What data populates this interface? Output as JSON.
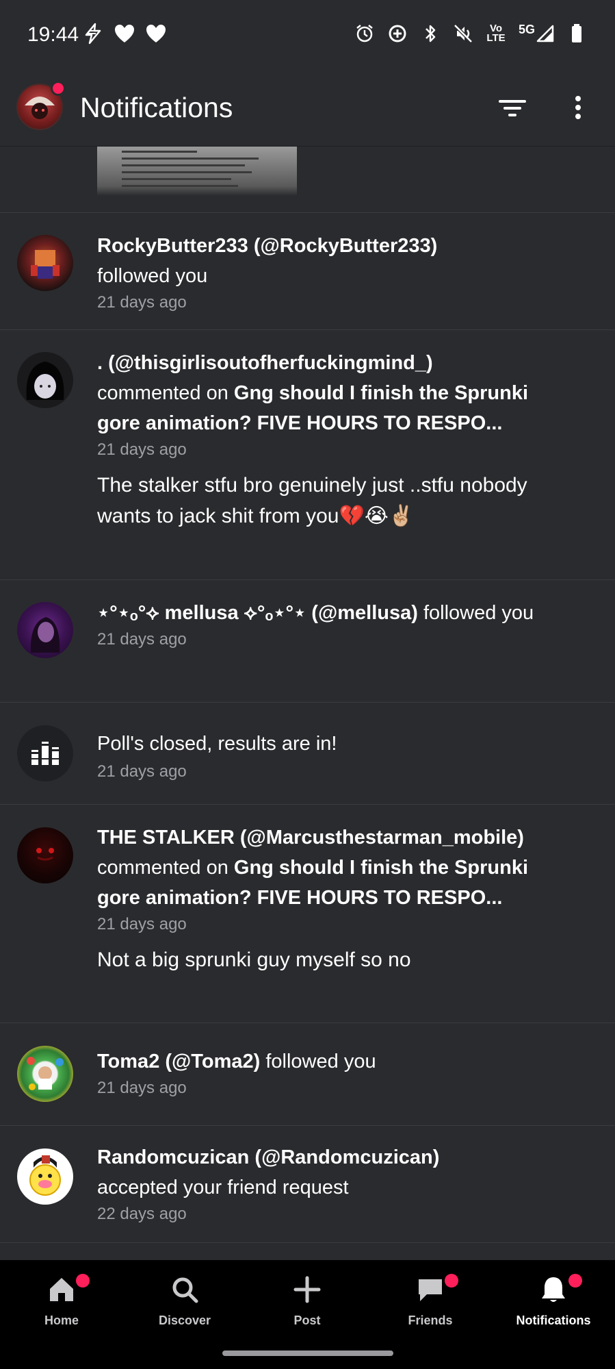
{
  "status_bar": {
    "time": "19:44",
    "network_label": "Vo½\nLTE",
    "network_top": "Vo",
    "network_bottom": "LTE",
    "fiveg": "5G"
  },
  "app_bar": {
    "title": "Notifications"
  },
  "notifications": [
    {
      "user": "RockyButter233 (@RockyButter233)",
      "action": "followed you",
      "time": "21 days ago"
    },
    {
      "user": ". (@thisgirlisoutofherfuckingmind_)",
      "action_prefix": "commented on",
      "post_title": "Gng should I finish the Sprunki gore animation? FIVE HOURS TO RESPO...",
      "time": "21 days ago",
      "comment": "The stalker stfu bro genuinely just ..stfu nobody wants to jack shit from you💔😭✌🏼"
    },
    {
      "user": "⋆°⋆ₒ°⟡ mellusa ⟡°ₒ⋆°⋆ (@mellusa)",
      "action": "followed you",
      "time": "21 days ago"
    },
    {
      "action": "Poll's closed, results are in!",
      "time": "21 days ago"
    },
    {
      "user": "THE STALKER (@Marcusthestarman_mobile)",
      "action_prefix": "commented on",
      "post_title": "Gng should I finish the Sprunki gore animation? FIVE HOURS TO RESPO...",
      "time": "21 days ago",
      "comment": "Not a big sprunki guy myself so no"
    },
    {
      "user": "Toma2 (@Toma2)",
      "action": "followed you",
      "time": "21 days ago"
    },
    {
      "user": "Randomcuzican (@Randomcuzican)",
      "action": "accepted your friend request",
      "time": "22 days ago"
    }
  ],
  "bottom_nav": {
    "items": [
      {
        "label": "Home",
        "icon": "home-icon",
        "badge": true
      },
      {
        "label": "Discover",
        "icon": "search-icon",
        "badge": false
      },
      {
        "label": "Post",
        "icon": "plus-icon",
        "badge": false
      },
      {
        "label": "Friends",
        "icon": "chat-icon",
        "badge": true
      },
      {
        "label": "Notifications",
        "icon": "bell-icon",
        "badge": true,
        "active": true
      }
    ]
  },
  "colors": {
    "background": "#2a2b2e",
    "divider": "#3b3c40",
    "badge": "#ff1f5a",
    "secondary_text": "#9ea0a6",
    "nav_background": "#000000"
  }
}
